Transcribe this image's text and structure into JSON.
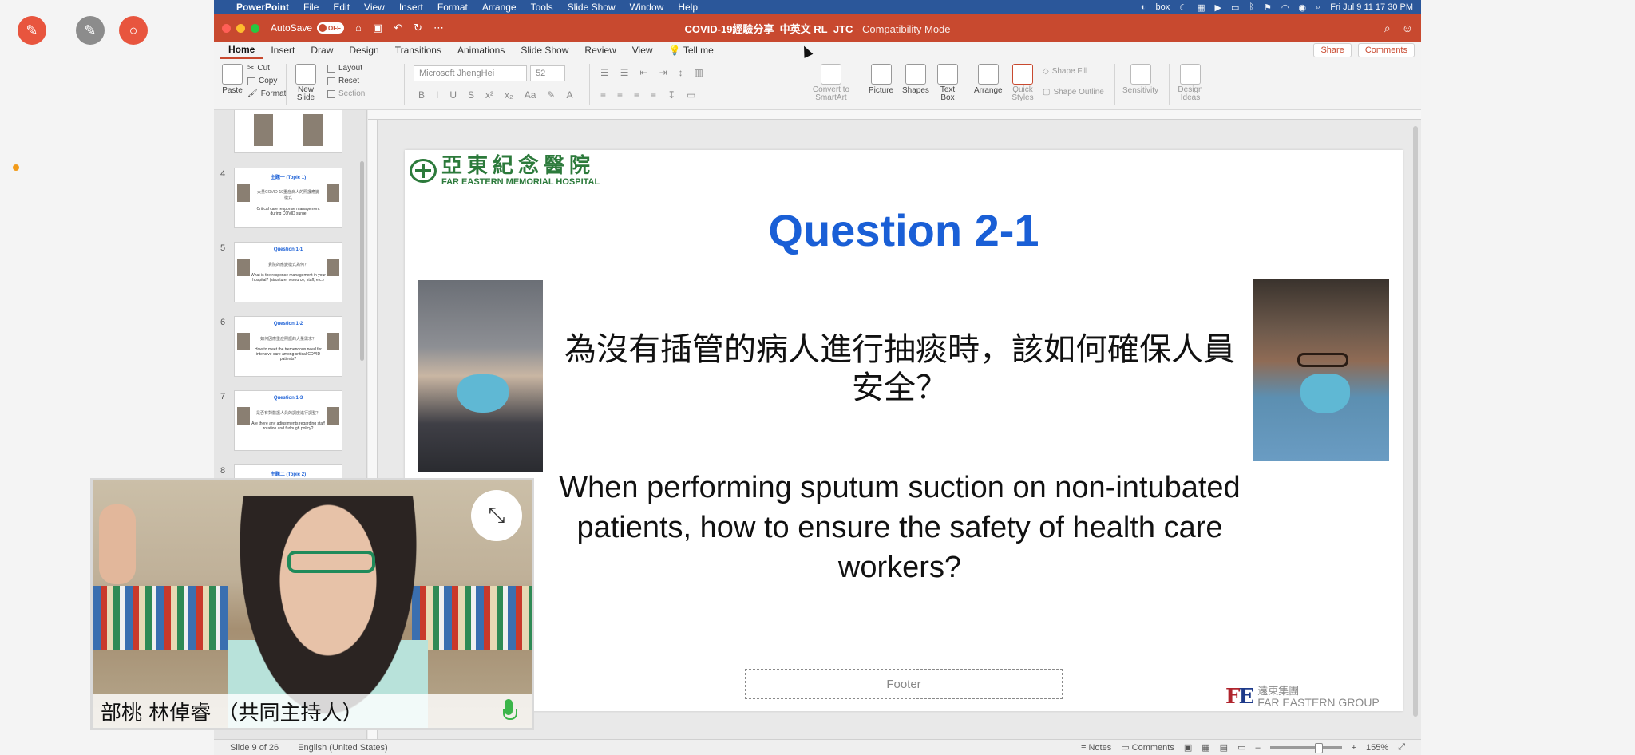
{
  "mac_menu": {
    "app_name": "PowerPoint",
    "items": [
      "File",
      "Edit",
      "View",
      "Insert",
      "Format",
      "Arrange",
      "Tools",
      "Slide Show",
      "Window",
      "Help"
    ],
    "box_label": "box",
    "clock": "Fri Jul 9  11 17 30 PM"
  },
  "titlebar": {
    "autosave_label": "AutoSave",
    "autosave_state": "OFF",
    "doc_title": "COVID-19經驗分享_中英文 RL_JTC",
    "mode": "-  Compatibility Mode"
  },
  "ribbon_tabs": [
    "Home",
    "Insert",
    "Draw",
    "Design",
    "Transitions",
    "Animations",
    "Slide Show",
    "Review",
    "View",
    "Tell me"
  ],
  "ribbon_actions": {
    "share": "Share",
    "comments": "Comments"
  },
  "ribbon": {
    "paste": "Paste",
    "cut": "Cut",
    "copy": "Copy",
    "format": "Format",
    "new_slide": "New Slide",
    "layout": "Layout",
    "reset": "Reset",
    "section": "Section",
    "font_name": "Microsoft JhengHei",
    "font_size": "52",
    "convert_smartart": "Convert to SmartArt",
    "picture": "Picture",
    "shapes": "Shapes",
    "text_box": "Text Box",
    "arrange": "Arrange",
    "quick_styles": "Quick Styles",
    "shape_fill": "Shape Fill",
    "shape_outline": "Shape Outline",
    "sensitivity": "Sensitivity",
    "design_ideas": "Design Ideas"
  },
  "thumbnails": [
    {
      "num": "4",
      "title": "主題一 (Topic 1)",
      "zh": "大量COVID-19重症病人的照護應變模式",
      "sub": "Critical care response management during COVID surge"
    },
    {
      "num": "5",
      "title": "Question 1-1",
      "zh": "貴院的應變模式為何？",
      "sub": "What is the response management in your hospital? (structure, resource, staff, etc.)"
    },
    {
      "num": "6",
      "title": "Question 1-2",
      "zh": "如何因應重症照護的大量需求？",
      "sub": "How to meet the tremendous need for intensive care among critical COVID patients?"
    },
    {
      "num": "7",
      "title": "Question 1-3",
      "zh": "是否有對醫護人員的調度進行調整？",
      "sub": "Are there any adjustments regarding staff rotation and furlough policy?"
    },
    {
      "num": "8",
      "title": "主題二 (Topic 2)",
      "zh": "",
      "sub": ""
    }
  ],
  "slide": {
    "logo_zh": "亞東紀念醫院",
    "logo_en": "FAR EASTERN MEMORIAL HOSPITAL",
    "title": "Question 2-1",
    "question_zh": "為沒有插管的病人進行抽痰時，該如何確保人員安全？",
    "question_en": "When performing sputum suction on non-intubated patients, how to ensure the safety of health care workers?",
    "footer": "Footer",
    "group_zh": "遠東集團",
    "group_en": "FAR EASTERN GROUP"
  },
  "status_bar": {
    "slide_info": "Slide 9 of 26",
    "language": "English (United States)",
    "notes": "Notes",
    "comments": "Comments",
    "zoom": "155%"
  },
  "self_view": {
    "name": "部桃 林倬睿 （共同主持人）"
  }
}
